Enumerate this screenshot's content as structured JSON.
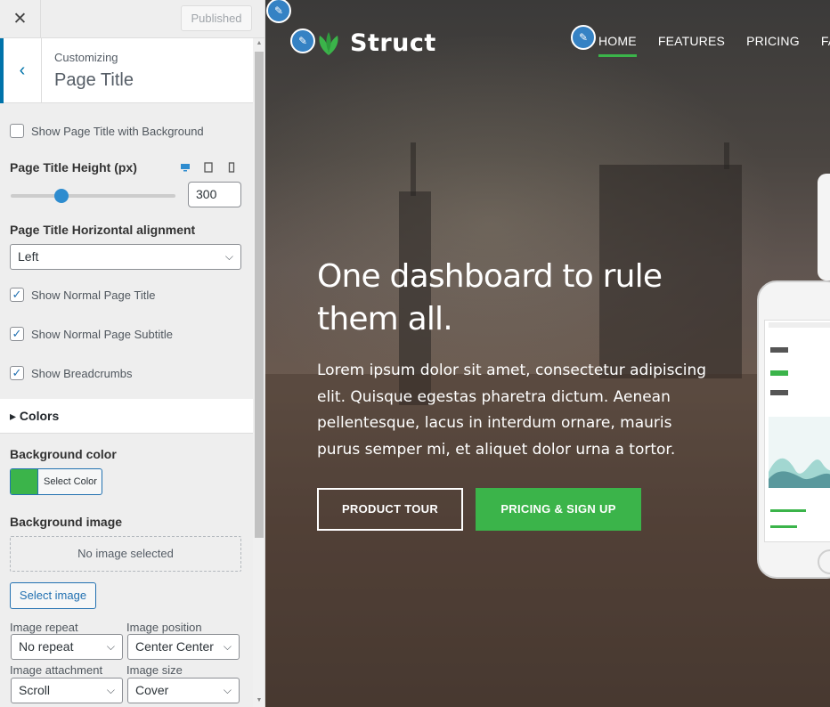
{
  "topbar": {
    "close_icon": "close-icon",
    "publish_label": "Published"
  },
  "section": {
    "customizing_label": "Customizing",
    "title": "Page Title",
    "back_icon": "chevron-left-icon"
  },
  "controls": {
    "show_title_bg": {
      "label": "Show Page Title with Background",
      "checked": false
    },
    "height": {
      "title": "Page Title Height (px)",
      "value": "300",
      "slider_fraction": 0.31,
      "device_icons": [
        "desktop-icon",
        "tablet-icon",
        "mobile-icon"
      ]
    },
    "alignment": {
      "title": "Page Title Horizontal alignment",
      "selected": "Left"
    },
    "show_normal_title": {
      "label": "Show Normal Page Title",
      "checked": true
    },
    "show_normal_subtitle": {
      "label": "Show Normal Page Subtitle",
      "checked": true
    },
    "show_breadcrumbs": {
      "label": "Show Breadcrumbs",
      "checked": true
    },
    "colors_section": "Colors",
    "bg_color": {
      "title": "Background color",
      "button_label": "Select Color",
      "value": "#3bb44a"
    },
    "bg_image": {
      "title": "Background image",
      "placeholder": "No image selected",
      "button_label": "Select image"
    },
    "image_repeat": {
      "label": "Image repeat",
      "selected": "No repeat"
    },
    "image_position": {
      "label": "Image position",
      "selected": "Center Center"
    },
    "image_attachment": {
      "label": "Image attachment",
      "selected": "Scroll"
    },
    "image_size": {
      "label": "Image size",
      "selected": "Cover"
    }
  },
  "preview": {
    "logo_text": "Struct",
    "nav": [
      "HOME",
      "FEATURES",
      "PRICING",
      "FAQ"
    ],
    "active_nav": "HOME",
    "hero_title": "One dashboard to rule them all.",
    "hero_text": "Lorem ipsum dolor sit amet, consectetur adipiscing elit. Quisque egestas pharetra dictum. Aenean pellentesque, lacus in interdum ornare, mauris purus semper mi, et aliquet dolor urna a tortor.",
    "btn_tour": "PRODUCT TOUR",
    "btn_pricing": "PRICING & SIGN UP",
    "accent_color": "#3bb44a",
    "edit_icon": "pencil-icon"
  }
}
